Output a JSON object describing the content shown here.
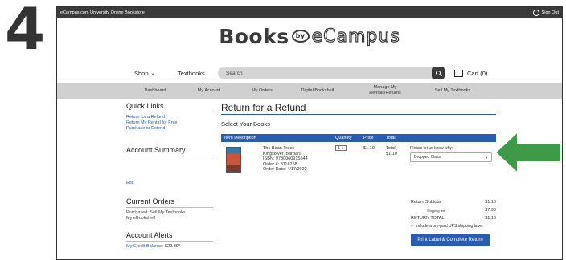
{
  "step": "4",
  "topbar": {
    "site_name": "eCampus.com University Online Bookstore",
    "signout": "Sign Out"
  },
  "logo": {
    "books": "Books",
    "by": "by",
    "ecampus": "eCampus"
  },
  "header": {
    "shop": "Shop",
    "textbooks": "Textbooks",
    "search_placeholder": "Search",
    "cart": "Cart (0)"
  },
  "nav": {
    "items": [
      "Dashboard",
      "My Account",
      "My Orders",
      "Digital Bookshelf",
      "Manage My Rentals/Returns",
      "Sell My Textbooks"
    ]
  },
  "sidebar": {
    "quick_links_title": "Quick Links",
    "quick_links": [
      "Return for a Refund",
      "Return My Rental for Free",
      "Purchase or Extend"
    ],
    "account_summary_title": "Account Summary",
    "edit": "Edit",
    "current_orders_title": "Current Orders",
    "current_orders": [
      "Purchased: Sell My Textbooks",
      "My eBookshelf"
    ],
    "account_alerts_title": "Account Alerts",
    "credit_label": "My Credit Balance:",
    "credit_value": "$22.80*"
  },
  "main": {
    "title": "Return for a Refund",
    "subtitle": "Select Your Books",
    "columns": [
      "Item Description",
      "Quantity",
      "Price",
      "Total"
    ],
    "item": {
      "title": "The Bean Trees",
      "author": "Kingsolver, Barbara",
      "isbn": "ISBN: 9780060915544",
      "order": "Order #: 8116758",
      "order_date": "Order Date: 4/17/2022",
      "quantity": "1",
      "price": "$1.10",
      "total_label": "Total:",
      "total": "$1.10"
    },
    "reason_label": "Please let us know why:",
    "reason_value": "Dropped Class"
  },
  "summary": {
    "subtotal_label": "Return Subtotal",
    "subtotal": "$1.10",
    "shipping_label": "Shipping fee",
    "shipping": "$7.90",
    "return_total_label": "RETURN TOTAL",
    "return_total": "$1.10",
    "ups_label": "Include a pre-paid UPS shipping label.",
    "button": "Print Label & Complete Return"
  },
  "colors": {
    "accent_blue": "#2a5db0",
    "arrow_green": "#3d9a46",
    "dark_bar": "#3a3a3a"
  }
}
